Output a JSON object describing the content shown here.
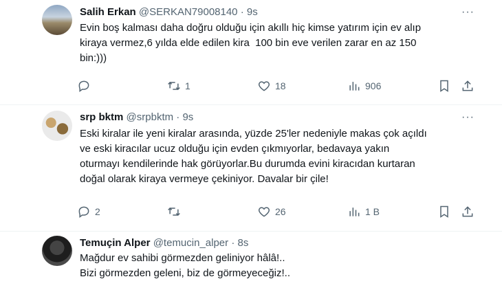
{
  "tweets": [
    {
      "name": "Salih Erkan",
      "handle": "@SERKAN79008140",
      "time": "9s",
      "text": "Evin boş kalması daha doğru olduğu için akıllı hiç kimse yatırım için ev alıp\nkiraya vermez,6 yılda elde edilen kira  100 bin eve verilen zarar en az 150\nbin:)))",
      "replies": "",
      "retweets": "1",
      "likes": "18",
      "views": "906"
    },
    {
      "name": "srp bktm",
      "handle": "@srpbktm",
      "time": "9s",
      "text": "Eski kiralar ile yeni kiralar arasında, yüzde 25'ler nedeniyle makas çok açıldı\nve eski kiracılar ucuz olduğu için evden çıkmıyorlar, bedavaya yakın\noturmayı kendilerinde hak görüyorlar.Bu durumda evini kiracıdan kurtaran\ndoğal olarak kiraya vermeye çekiniyor. Davalar bir çile!",
      "replies": "2",
      "retweets": "",
      "likes": "26",
      "views": "1 B"
    },
    {
      "name": "Temuçin Alper",
      "handle": "@temucin_alper",
      "time": "8s",
      "text": "Mağdur ev sahibi görmezden geliniyor hâlâ!..\nBizi görmezden geleni, biz de görmeyeceğiz!.."
    }
  ],
  "separator": "·",
  "more_glyph": "···"
}
